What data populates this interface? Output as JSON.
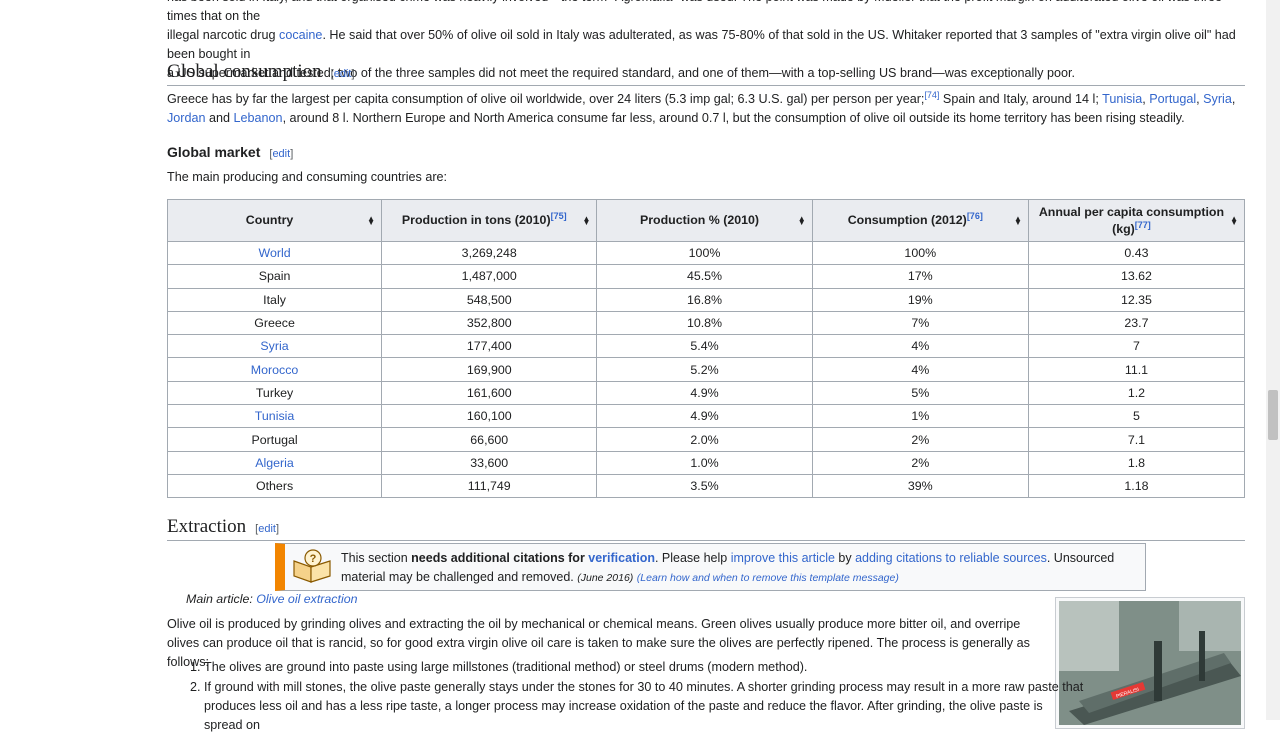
{
  "top_paragraph": {
    "line1": "has been sold in Italy, and that organised crime was heavily involved—the term \"Agromafia\" was used. The point was made by Mueller that the profit margin on adulterated olive oil was three times that on the",
    "line2_a": "illegal narcotic drug ",
    "line2_link": "cocaine",
    "line2_b": ". He said that over 50% of olive oil sold in Italy was adulterated, as was 75-80% of that sold in the US. Whitaker reported that 3 samples of \"extra virgin olive oil\" had been bought in",
    "line3": "a US supermarket and tested; two of the three samples did not meet the required standard, and one of them—with a top-selling US brand—was exceptionally poor."
  },
  "global_consumption": {
    "heading": "Global consumption",
    "edit": "edit",
    "text_a": "Greece has by far the largest per capita consumption of olive oil worldwide, over 24 liters (5.3 imp gal; 6.3 U.S. gal) per person per year;",
    "ref": "[74]",
    "text_b": " Spain and Italy, around 14 l; ",
    "links": [
      "Tunisia",
      "Portugal",
      "Syria",
      "Jordan",
      "Lebanon"
    ],
    "and": " and ",
    "text_c": ", around 8 l. Northern Europe and North America consume far less, around 0.7 l, but the consumption of olive oil outside its home territory has been rising steadily."
  },
  "global_market": {
    "heading": "Global market",
    "edit": "edit",
    "intro": "The main producing and consuming countries are:"
  },
  "table": {
    "headers": [
      {
        "label": "Country",
        "ref": ""
      },
      {
        "label": "Production in tons (2010)",
        "ref": "[75]"
      },
      {
        "label": "Production % (2010)",
        "ref": ""
      },
      {
        "label": "Consumption (2012)",
        "ref": "[76]"
      },
      {
        "label": "Annual per capita consumption (kg)",
        "ref": "[77]"
      }
    ],
    "rows": [
      {
        "country": "World",
        "link": true,
        "production": "3,269,248",
        "pct": "100%",
        "consumption": "100%",
        "per_capita": "0.43"
      },
      {
        "country": "Spain",
        "link": false,
        "production": "1,487,000",
        "pct": "45.5%",
        "consumption": "17%",
        "per_capita": "13.62"
      },
      {
        "country": "Italy",
        "link": false,
        "production": "548,500",
        "pct": "16.8%",
        "consumption": "19%",
        "per_capita": "12.35"
      },
      {
        "country": "Greece",
        "link": false,
        "production": "352,800",
        "pct": "10.8%",
        "consumption": "7%",
        "per_capita": "23.7"
      },
      {
        "country": "Syria",
        "link": true,
        "production": "177,400",
        "pct": "5.4%",
        "consumption": "4%",
        "per_capita": "7"
      },
      {
        "country": "Morocco",
        "link": true,
        "production": "169,900",
        "pct": "5.2%",
        "consumption": "4%",
        "per_capita": "11.1"
      },
      {
        "country": "Turkey",
        "link": false,
        "production": "161,600",
        "pct": "4.9%",
        "consumption": "5%",
        "per_capita": "1.2"
      },
      {
        "country": "Tunisia",
        "link": true,
        "production": "160,100",
        "pct": "4.9%",
        "consumption": "1%",
        "per_capita": "5"
      },
      {
        "country": "Portugal",
        "link": false,
        "production": "66,600",
        "pct": "2.0%",
        "consumption": "2%",
        "per_capita": "7.1"
      },
      {
        "country": "Algeria",
        "link": true,
        "production": "33,600",
        "pct": "1.0%",
        "consumption": "2%",
        "per_capita": "1.8"
      },
      {
        "country": "Others",
        "link": false,
        "production": "111,749",
        "pct": "3.5%",
        "consumption": "39%",
        "per_capita": "1.18"
      }
    ]
  },
  "extraction": {
    "heading": "Extraction",
    "edit": "edit",
    "ambox": {
      "a": "This section ",
      "bold": "needs additional citations for ",
      "verification": "verification",
      "b": ". Please help ",
      "improve": "improve this article",
      "c": " by ",
      "adding": "adding citations to reliable sources",
      "d": ". Unsourced material may be challenged and removed. ",
      "date": "(June 2016)",
      "learn": "(Learn how and when to remove this template message)"
    },
    "hatnote_prefix": "Main article: ",
    "hatnote_link": "Olive oil extraction",
    "paragraph": "Olive oil is produced by grinding olives and extracting the oil by mechanical or chemical means. Green olives usually produce more bitter oil, and overripe olives can produce oil that is rancid, so for good extra virgin olive oil care is taken to make sure the olives are perfectly ripened. The process is generally as follows:",
    "steps": [
      "The olives are ground into paste using large millstones (traditional method) or steel drums (modern method).",
      "If ground with mill stones, the olive paste generally stays under the stones for 30 to 40 minutes. A shorter grinding process may result in a more raw paste that produces less oil and has a less ripe taste, a longer process may increase oxidation of the paste and reduce the flavor. After grinding, the olive paste is spread on"
    ],
    "image_label": "PIERALISI"
  },
  "colors": {
    "link": "#3366cc",
    "header_bg": "#eaecf0",
    "border": "#a2a9b1",
    "ambox_accent": "#f28500"
  }
}
